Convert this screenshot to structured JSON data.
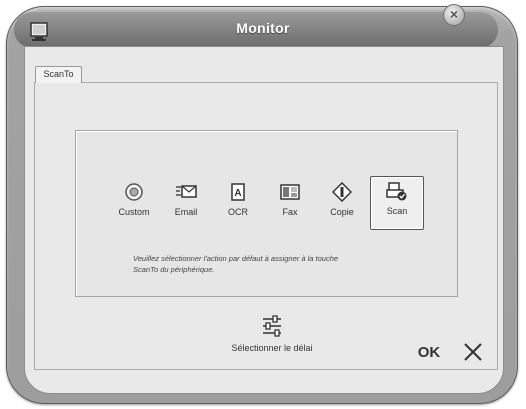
{
  "window": {
    "title": "Monitor"
  },
  "tabs": [
    {
      "label": "ScanTo",
      "selected": true
    }
  ],
  "actions": [
    {
      "label": "Custom",
      "icon": "custom-icon"
    },
    {
      "label": "Email",
      "icon": "email-icon"
    },
    {
      "label": "OCR",
      "icon": "ocr-icon"
    },
    {
      "label": "Fax",
      "icon": "fax-icon"
    },
    {
      "label": "Copie",
      "icon": "copy-icon"
    },
    {
      "label": "Scan",
      "icon": "scan-icon",
      "selected": true
    }
  ],
  "info_text_line1": "Veuillez sélectionner l'action par défaut à assigner à la touche",
  "info_text_line2": "ScanTo du périphérique.",
  "delay_button": {
    "label": "Sélectionner le délai",
    "icon": "delay-settings-icon"
  },
  "footer": {
    "ok_label": "OK",
    "cancel_icon": "close-x-icon"
  }
}
